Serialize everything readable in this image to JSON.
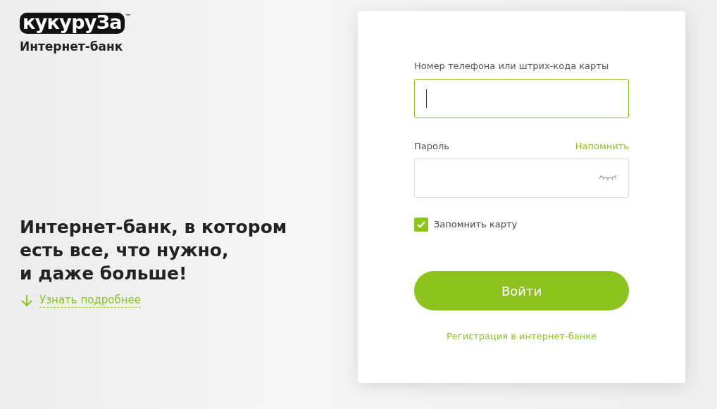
{
  "brand": {
    "logo": "кукуруЗа",
    "trademark": "™",
    "subtitle": "Интернет-банк"
  },
  "headline": [
    "Интернет-банк, в котором",
    "есть все, что нужно,",
    "и даже больше!"
  ],
  "more_link": "Узнать подробнее",
  "login": {
    "phone_label": "Номер телефона или штрих-кода карты",
    "phone_focused": true,
    "password_label": "Пароль",
    "remind_link": "Напомнить",
    "remember": {
      "label": "Запомнить карту",
      "checked": true
    },
    "submit": "Войти",
    "register_link": "Регистрация в интернет-банке"
  }
}
